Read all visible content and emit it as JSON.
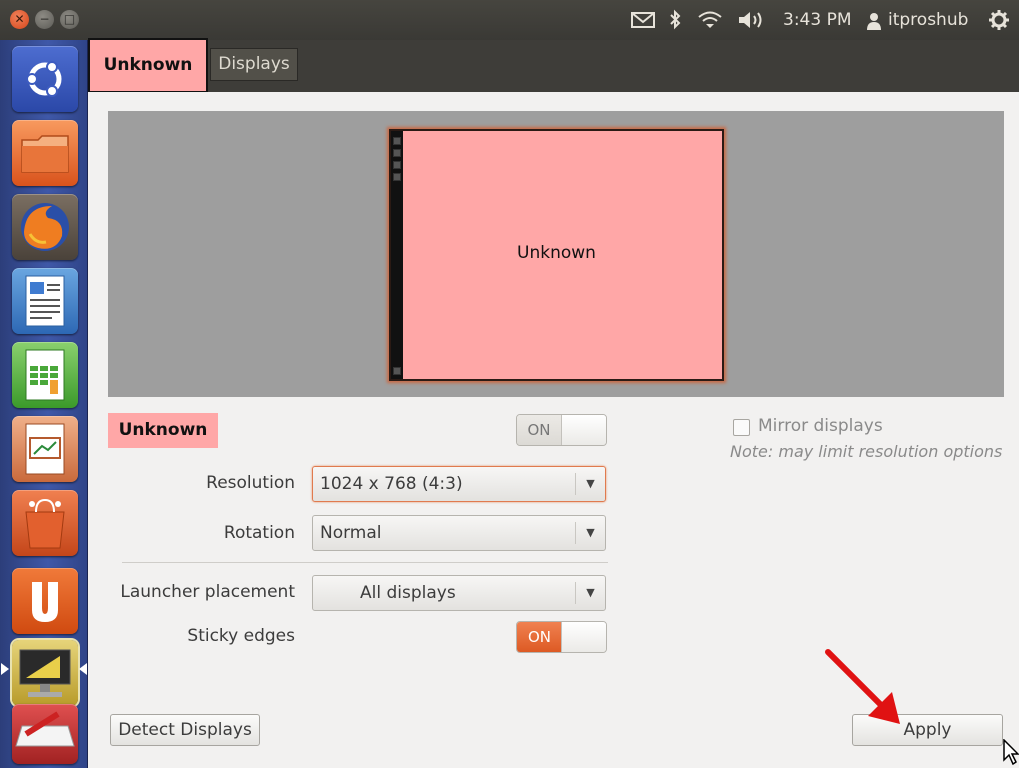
{
  "top_panel": {
    "time": "3:43 PM",
    "user": "itproshub",
    "icons": [
      "mail-icon",
      "bluetooth-icon",
      "wifi-icon",
      "volume-icon",
      "user-icon",
      "gear-icon"
    ]
  },
  "window_controls": {
    "close_glyph": "✕",
    "minimize_glyph": "−",
    "maximize_glyph": "□"
  },
  "tabs": [
    {
      "label": "Unknown"
    },
    {
      "label": "Displays"
    }
  ],
  "preview": {
    "monitor_label": "Unknown"
  },
  "display": {
    "name": "Unknown",
    "toggle_label": "ON"
  },
  "form": {
    "resolution_label": "Resolution",
    "resolution_value": "1024 x 768 (4:3)",
    "rotation_label": "Rotation",
    "rotation_value": "Normal",
    "launcher_label": "Launcher placement",
    "launcher_value": "All displays",
    "sticky_label": "Sticky edges",
    "sticky_toggle_label": "ON"
  },
  "mirror": {
    "label": "Mirror displays",
    "note": "Note: may limit resolution options"
  },
  "buttons": {
    "detect": "Detect Displays",
    "apply": "Apply"
  },
  "launcher_items": [
    "ubuntu-dash-icon",
    "files-icon",
    "firefox-icon",
    "writer-icon",
    "calc-icon",
    "impress-icon",
    "software-center-icon",
    "ubuntu-one-icon",
    "system-settings-icon",
    "workspace-icon"
  ],
  "colors": {
    "accent": "#e0622e",
    "highlight_pink": "#ffa7a7",
    "launcher_blue": "#3f58a8"
  }
}
